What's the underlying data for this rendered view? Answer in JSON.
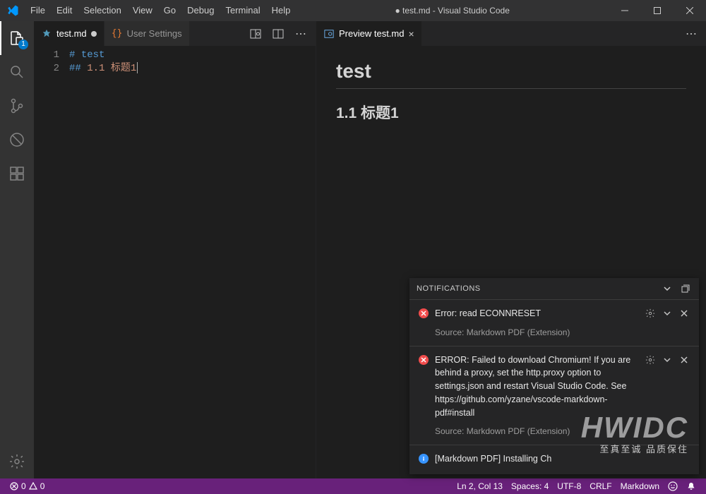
{
  "titlebar": {
    "title": "● test.md - Visual Studio Code",
    "menu": [
      "File",
      "Edit",
      "Selection",
      "View",
      "Go",
      "Debug",
      "Terminal",
      "Help"
    ]
  },
  "activitybar": {
    "explorer_badge": "1"
  },
  "editor_left": {
    "tabs": [
      {
        "label": "test.md",
        "dirty": true,
        "active": true,
        "icon": "pin"
      },
      {
        "label": "User Settings",
        "dirty": false,
        "active": false,
        "icon": "braces"
      }
    ],
    "lines": [
      {
        "num": "1",
        "hash": "# ",
        "text": "test"
      },
      {
        "num": "2",
        "hash": "## ",
        "text": "1.1 标题1"
      }
    ]
  },
  "editor_right": {
    "tabs": [
      {
        "label": "Preview test.md",
        "active": true,
        "icon": "preview"
      }
    ],
    "preview": {
      "h1": "test",
      "h2": "1.1 标题1"
    }
  },
  "notifications": {
    "title": "NOTIFICATIONS",
    "items": [
      {
        "kind": "error",
        "message": "Error: read ECONNRESET",
        "source": "Source: Markdown PDF (Extension)"
      },
      {
        "kind": "error",
        "message": "ERROR: Failed to download Chromium! If you are behind a proxy, set the http.proxy option to settings.json and restart Visual Studio Code. See https://github.com/yzane/vscode-markdown-pdf#install",
        "source": "Source: Markdown PDF (Extension)"
      },
      {
        "kind": "info",
        "message": "[Markdown PDF] Installing Chromium…",
        "truncated": "[Markdown PDF] Installing Ch"
      }
    ]
  },
  "statusbar": {
    "left": {
      "errors": "0",
      "warnings": "0"
    },
    "right": {
      "position": "Ln 2, Col 13",
      "spaces": "Spaces: 4",
      "encoding": "UTF-8",
      "eol": "CRLF",
      "language": "Markdown"
    }
  },
  "watermark": {
    "big": "HWIDC",
    "small": "至真至诚  品质保住"
  }
}
